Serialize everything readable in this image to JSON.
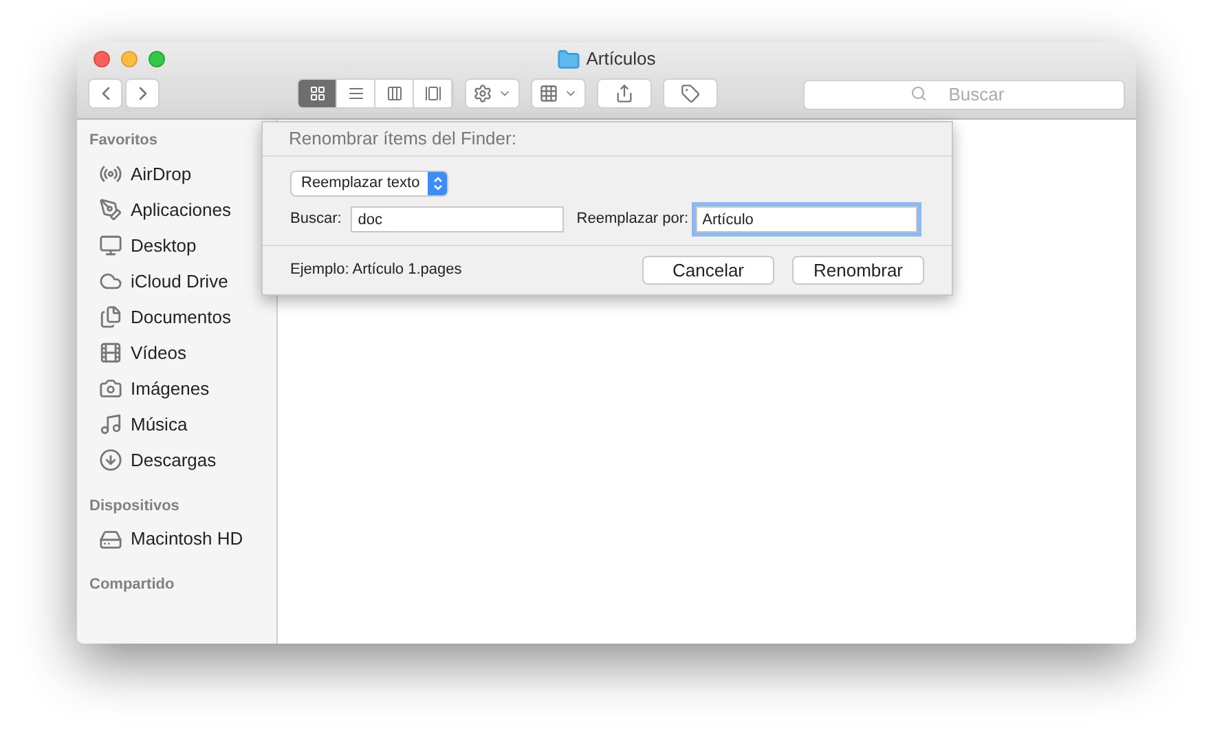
{
  "window": {
    "title": "Artículos"
  },
  "toolbar": {
    "view_modes": [
      {
        "selected": true
      },
      {
        "selected": false
      },
      {
        "selected": false
      },
      {
        "selected": false
      }
    ],
    "search": {
      "placeholder": "Buscar"
    }
  },
  "sidebar": {
    "sections": [
      {
        "title": "Favoritos",
        "items": [
          "AirDrop",
          "Aplicaciones",
          "Desktop",
          "iCloud Drive",
          "Documentos",
          "Vídeos",
          "Imágenes",
          "Música",
          "Descargas"
        ]
      },
      {
        "title": "Dispositivos",
        "items": [
          "Macintosh HD"
        ]
      },
      {
        "title": "Compartido"
      }
    ]
  },
  "rename_sheet": {
    "title": "Renombrar ítems del Finder:",
    "mode": "Reemplazar texto",
    "find_label": "Buscar:",
    "find_value": "doc",
    "replace_label": "Reemplazar por:",
    "replace_value": "Artículo",
    "example": "Ejemplo: Artículo 1.pages",
    "buttons": [
      "Cancelar",
      "Renombrar"
    ]
  }
}
